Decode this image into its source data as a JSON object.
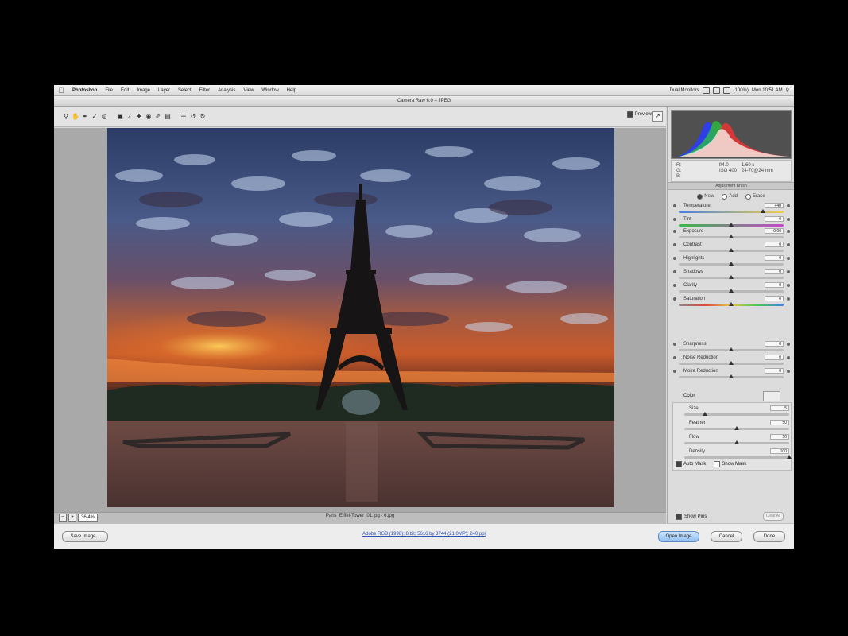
{
  "menubar": {
    "apple": "",
    "app_name": "Photoshop",
    "items": [
      "File",
      "Edit",
      "Image",
      "Layer",
      "Select",
      "Filter",
      "Analysis",
      "View",
      "Window",
      "Help"
    ],
    "status_left": "Dual Monitors",
    "battery": "(100%)",
    "time": "Mon 10:51 AM"
  },
  "window": {
    "title": "Camera Raw 6.0 – JPEG"
  },
  "toolbar": {
    "tools": [
      "zoom-tool",
      "hand-tool",
      "white-balance-tool",
      "color-sampler-tool",
      "targeted-adjustment-tool",
      "crop-tool",
      "straighten-tool",
      "spot-removal-tool",
      "red-eye-tool",
      "adjustment-brush-tool",
      "graduated-filter-tool",
      "preferences",
      "rotate-left",
      "rotate-right"
    ],
    "preview_label": "Preview"
  },
  "rgb": {
    "r_label": "R:",
    "g_label": "G:",
    "b_label": "B:",
    "r_value": "f/4.0",
    "g_value": "ISO 400",
    "b_value": "",
    "shutter": "1/60 s",
    "focal": "24-70@24 mm"
  },
  "panel": {
    "section_title": "Adjustment Brush",
    "mode_new": "New",
    "mode_add": "Add",
    "mode_erase": "Erase",
    "sliders": [
      {
        "label": "Temperature",
        "value": "+40",
        "pos": 0.8,
        "track": "temp"
      },
      {
        "label": "Tint",
        "value": "0",
        "pos": 0.5,
        "track": "tint"
      },
      {
        "label": "Exposure",
        "value": "0.00",
        "pos": 0.5,
        "track": ""
      },
      {
        "label": "Contrast",
        "value": "0",
        "pos": 0.5,
        "track": ""
      },
      {
        "label": "Highlights",
        "value": "0",
        "pos": 0.5,
        "track": ""
      },
      {
        "label": "Shadows",
        "value": "0",
        "pos": 0.5,
        "track": ""
      },
      {
        "label": "Clarity",
        "value": "0",
        "pos": 0.5,
        "track": ""
      },
      {
        "label": "Saturation",
        "value": "0",
        "pos": 0.5,
        "track": "sat"
      },
      {
        "label": "Sharpness",
        "value": "0",
        "pos": 0.5,
        "track": ""
      },
      {
        "label": "Noise Reduction",
        "value": "0",
        "pos": 0.5,
        "track": ""
      },
      {
        "label": "Moire Reduction",
        "value": "0",
        "pos": 0.5,
        "track": ""
      }
    ],
    "color_label": "Color",
    "brush_sliders": [
      {
        "label": "Size",
        "value": "5",
        "pos": 0.2
      },
      {
        "label": "Feather",
        "value": "50",
        "pos": 0.5
      },
      {
        "label": "Flow",
        "value": "50",
        "pos": 0.5
      },
      {
        "label": "Density",
        "value": "100",
        "pos": 1.0
      }
    ],
    "auto_mask": "Auto Mask",
    "show_mask": "Show Mask",
    "show_pins": "Show Pins",
    "clear_all": "Clear All"
  },
  "canvas": {
    "zoom": "36.4%",
    "filename": "Paris_Eiffel-Tower_01.jpg  ·  6.jpg"
  },
  "footer": {
    "save_image": "Save Image...",
    "workflow": "Adobe RGB (1998); 8 bit; 5616 by 3744 (21.0MP); 240 ppi",
    "open_image": "Open Image",
    "cancel": "Cancel",
    "done": "Done"
  },
  "colors": {
    "sky_top": "#2b3c66",
    "sunset_orange": "#e0702a",
    "plaza": "#5a3c36"
  }
}
